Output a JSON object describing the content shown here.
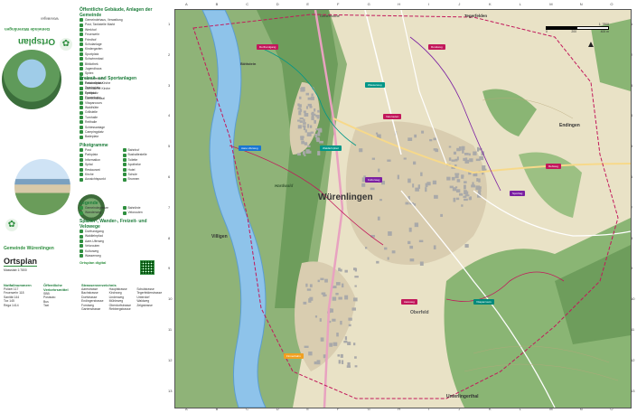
{
  "panel": {
    "brand_title": "Ortsplan",
    "brand_sub": "Gemeinde Würenlingen",
    "brand_small": "Würenlingen",
    "colors": {
      "accent": "#2f8f3f",
      "pink": "#c2185b",
      "teal": "#009688",
      "purple": "#7b1fa2",
      "orange": "#f0a020"
    },
    "sec1_title": "Öffentliche Gebäude, Anlagen der Gemeinde",
    "sec1_items": [
      "Gemeindehaus, Verwaltung",
      "Post, Tankstelle Markt",
      "Werkhof",
      "Feuerwehr",
      "Friedhof",
      "Schulanlage",
      "Kindergarten",
      "Sportplatz",
      "Schwimmbad",
      "Bibliothek",
      "Jugendhaus",
      "Spitex",
      "Alterszentrum",
      "Reformierte Kirche",
      "Katholische Kirche",
      "Freibad",
      "Gemeindesaal"
    ],
    "sec2_title": "Freizeit- und Sportanlagen",
    "sec2_items": [
      "Fussballplatz",
      "Tennisplatz",
      "Spielplatz",
      "Finnenbahn",
      "Vitaparcours",
      "Waldhütte",
      "Grillstelle",
      "Turnhalle",
      "Reithalle",
      "Schiessanlage",
      "Campingplatz",
      "Badeplatz"
    ],
    "sec3_title": "Pikotgramme",
    "sec3_items": [
      "Post",
      "Bahnhof",
      "Parkplatz",
      "Bushaltestelle",
      "Information",
      "Toilette",
      "Spital",
      "Apotheke",
      "Restaurant",
      "Hotel",
      "Kirche",
      "Schule",
      "Aussichtspunkt",
      "Brunnen"
    ],
    "sec4_title": "Legende",
    "sec4_items": [
      "Gemeindegrenze",
      "Bahnlinie",
      "Wanderweg",
      "Velorouten"
    ],
    "sec5_title": "Spazier-, Wander-, Freizeit- und Velowege",
    "sec5_items": [
      "Dorfrundgang",
      "Waldlehrpfad",
      "Aare-Uferweg",
      "Velorouten",
      "Kulturweg",
      "Wasserweg"
    ],
    "footer_title": "Gemeinde Würenlingen",
    "footer_ortsplan": "Ortsplan",
    "footer_scale": "Massstab 1:7800",
    "footer_digital": "Ortsplan digital",
    "bottom_cols": [
      {
        "title": "Notfallnummern",
        "items": [
          "Polizei 117",
          "Feuerwehr 118",
          "Sanität 144",
          "Tox 145",
          "Rega 1414"
        ]
      },
      {
        "title": "Öffentliche Verkehrsmittel",
        "items": [
          "SBB",
          "Postauto",
          "Bus",
          "Taxi"
        ]
      },
      {
        "title": "Strassenverzeichnis",
        "items": [
          "Aarestrasse",
          "Bachstrasse",
          "Dorfstrasse",
          "Endingerstrasse",
          "Forstweg",
          "Gartenstrasse",
          "Hauptstrasse",
          "Kirchweg",
          "Lindenweg",
          "Mühleweg",
          "Oberdorfstrasse",
          "Rebbergstrasse",
          "Schulstrasse",
          "Tegerfelderstrasse",
          "Unterdorf",
          "Waldweg",
          "Zelgstrasse"
        ]
      }
    ]
  },
  "map": {
    "top_labels": [
      "Gebenhalde",
      "Tegerfelden"
    ],
    "places": {
      "main": "Würenlingen",
      "east": "Endingen",
      "south": "Unterlingerthal",
      "villigen": "Villigen",
      "oberfeld": "Oberfeld",
      "boettstein": "Böttstein",
      "wald": "Hardwald"
    },
    "scale_text": "1: 7800",
    "scale_ticks": [
      "0",
      "200",
      "400 m"
    ],
    "grid_letters": [
      "A",
      "B",
      "C",
      "D",
      "E",
      "F",
      "G",
      "H",
      "I",
      "J",
      "K",
      "L",
      "M",
      "N",
      "O"
    ],
    "grid_numbers": [
      "1",
      "2",
      "3",
      "4",
      "5",
      "6",
      "7",
      "8",
      "9",
      "10",
      "11",
      "12",
      "13"
    ],
    "route_tags": [
      {
        "label": "Dorfrundgang",
        "color": "#c2185b"
      },
      {
        "label": "Waldlehrpfad",
        "color": "#009688"
      },
      {
        "label": "Aare-Uferweg",
        "color": "#1976d2"
      },
      {
        "label": "Kulturweg",
        "color": "#7b1fa2"
      },
      {
        "label": "Velorouten",
        "color": "#c2185b"
      },
      {
        "label": "Wasserweg",
        "color": "#009688"
      },
      {
        "label": "Rebweg",
        "color": "#c2185b"
      },
      {
        "label": "Finnenbahn",
        "color": "#f0a020"
      },
      {
        "label": "Vitaparcours",
        "color": "#00897b"
      },
      {
        "label": "Aareweg",
        "color": "#c2185b"
      },
      {
        "label": "Rundweg",
        "color": "#c2185b"
      },
      {
        "label": "Sporttag",
        "color": "#7b1fa2"
      }
    ]
  }
}
